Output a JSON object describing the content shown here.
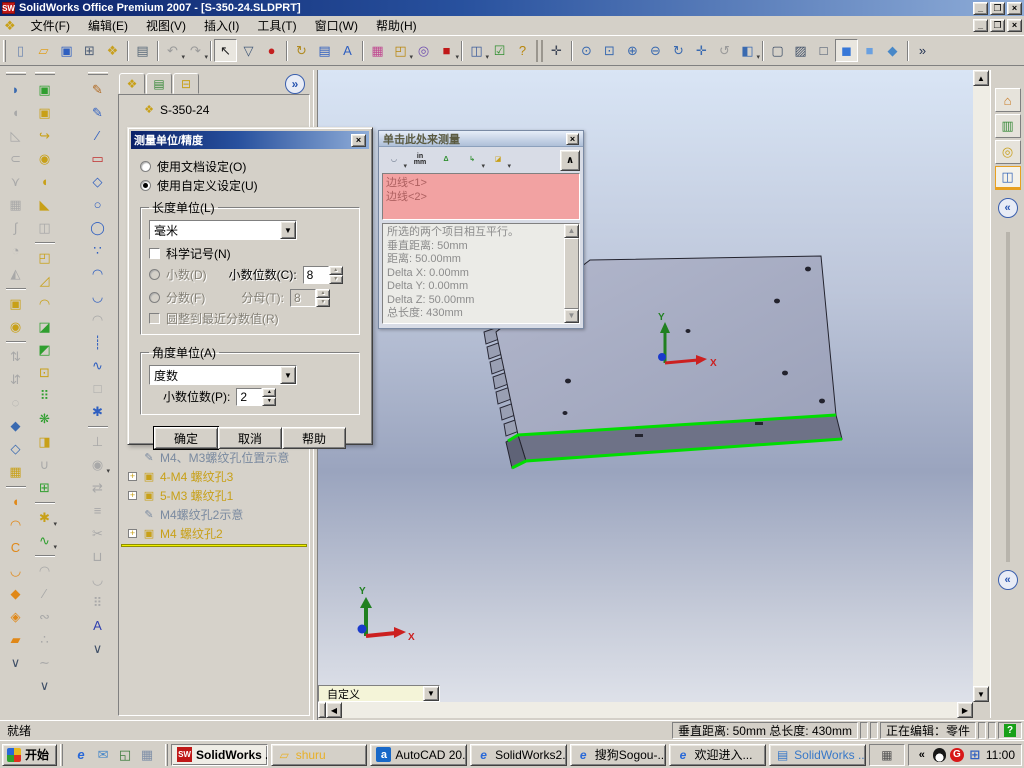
{
  "window": {
    "title": "SolidWorks Office Premium 2007 - [S-350-24.SLDPRT]"
  },
  "menubar": {
    "items": [
      "文件(F)",
      "编辑(E)",
      "视图(V)",
      "插入(I)",
      "工具(T)",
      "窗口(W)",
      "帮助(H)"
    ]
  },
  "main_toolbar": [
    {
      "name": "new-document-icon",
      "glyph": "▯",
      "color": "#7088b0"
    },
    {
      "name": "open-folder-icon",
      "glyph": "▱",
      "color": "#e0a020"
    },
    {
      "name": "save-icon",
      "glyph": "▣",
      "color": "#2f5fc0"
    },
    {
      "name": "make-drawing-icon",
      "glyph": "⊞",
      "color": "#506078"
    },
    {
      "name": "make-assembly-icon",
      "glyph": "❖",
      "color": "#c8a020"
    },
    {
      "cls": "sep"
    },
    {
      "name": "print-icon",
      "glyph": "▤",
      "color": "#5a6a7a"
    },
    {
      "cls": "sep"
    },
    {
      "name": "undo-icon",
      "glyph": "↶",
      "color": "#9a9a9a",
      "cls": "dis drop"
    },
    {
      "name": "redo-icon",
      "glyph": "↷",
      "color": "#9a9a9a",
      "cls": "dis drop"
    },
    {
      "cls": "sep"
    },
    {
      "name": "select-arrow-icon",
      "glyph": "↖",
      "color": "#202020",
      "cls": "pressed"
    },
    {
      "name": "selection-filter-icon",
      "glyph": "▽",
      "color": "#405878"
    },
    {
      "name": "traffic-light-icon",
      "glyph": "●",
      "color": "#c42020"
    },
    {
      "cls": "sep"
    },
    {
      "name": "rebuild-icon",
      "glyph": "↻",
      "color": "#b08a20"
    },
    {
      "name": "section-view-icon",
      "glyph": "▤",
      "color": "#2f5fc0"
    },
    {
      "name": "annotation-scale-icon",
      "glyph": "A",
      "color": "#2f5fc0"
    },
    {
      "cls": "sep"
    },
    {
      "name": "edit-color-icon",
      "glyph": "▦",
      "color": "#c04890"
    },
    {
      "name": "texture-icon",
      "glyph": "◰",
      "color": "#b8860b",
      "cls": "drop"
    },
    {
      "name": "photoworks-render-icon",
      "glyph": "◎",
      "color": "#7050b0"
    },
    {
      "name": "solidworks-cube-icon",
      "glyph": "■",
      "color": "#c01818",
      "cls": "drop"
    },
    {
      "cls": "sep"
    },
    {
      "name": "viewport-split-icon",
      "glyph": "◫",
      "color": "#3a5a9a",
      "cls": "drop"
    },
    {
      "name": "design-checker-icon",
      "glyph": "☑",
      "color": "#2f8f2f"
    },
    {
      "name": "help-icon",
      "glyph": "?",
      "color": "#b8860b"
    },
    {
      "cls": "sep2"
    },
    {
      "name": "magnetic-snap-icon",
      "glyph": "✛",
      "color": "#404858"
    },
    {
      "cls": "sep"
    },
    {
      "name": "zoom-fit-icon",
      "glyph": "⊙",
      "color": "#3a6ab0"
    },
    {
      "name": "zoom-area-icon",
      "glyph": "⊡",
      "color": "#3a6ab0"
    },
    {
      "name": "zoom-in-out-icon",
      "glyph": "⊕",
      "color": "#3a6ab0"
    },
    {
      "name": "zoom-selection-icon",
      "glyph": "⊖",
      "color": "#3a6ab0"
    },
    {
      "name": "rotate-view-icon",
      "glyph": "↻",
      "color": "#3a6ab0"
    },
    {
      "name": "pan-icon",
      "glyph": "✛",
      "color": "#3a6ab0"
    },
    {
      "name": "rotate-about-scene-icon",
      "glyph": "↺",
      "color": "#9a9a9a",
      "cls": "dis"
    },
    {
      "name": "view-orientation-icon",
      "glyph": "◧",
      "color": "#3a6ab0",
      "cls": "drop"
    },
    {
      "cls": "sep"
    },
    {
      "name": "wireframe-icon",
      "glyph": "▢",
      "color": "#405068"
    },
    {
      "name": "hidden-lines-visible-icon",
      "glyph": "▨",
      "color": "#405068"
    },
    {
      "name": "hidden-lines-removed-icon",
      "glyph": "□",
      "color": "#405068"
    },
    {
      "name": "shaded-with-edges-icon",
      "glyph": "◼",
      "color": "#3878d8",
      "cls": "pressed"
    },
    {
      "name": "shaded-icon",
      "glyph": "■",
      "color": "#6aa0e0"
    },
    {
      "name": "shadows-icon",
      "glyph": "◆",
      "color": "#4888c8"
    },
    {
      "cls": "sep"
    },
    {
      "name": "toolbar-overflow-icon",
      "glyph": "»",
      "color": "#203050"
    }
  ],
  "toolbar_surfaces": [
    {
      "name": "extruded-surface-icon",
      "glyph": "◗",
      "color": "#3a6ab0"
    },
    {
      "name": "lofted-surface-icon",
      "glyph": "◖",
      "color": "#a8a8a8",
      "cls": "dis"
    },
    {
      "name": "planar-surface-icon",
      "glyph": "◺",
      "color": "#a8a8a8",
      "cls": "dis"
    },
    {
      "name": "offset-surface-icon",
      "glyph": "⊂",
      "color": "#a8a8a8",
      "cls": "dis"
    },
    {
      "name": "ruled-surface-icon",
      "glyph": "⋎",
      "color": "#a8a8a8",
      "cls": "dis"
    },
    {
      "name": "knit-surface-icon",
      "glyph": "▦",
      "color": "#a8a8a8",
      "cls": "dis"
    },
    {
      "name": "swept-surface-icon",
      "glyph": "∫",
      "color": "#a8a8a8",
      "cls": "dis"
    },
    {
      "name": "fill-surface-icon",
      "glyph": "◔",
      "color": "#a8a8a8",
      "cls": "dis"
    },
    {
      "name": "mid-surface-icon",
      "glyph": "◭",
      "color": "#a8a8a8",
      "cls": "dis"
    },
    {
      "cls": "sep"
    },
    {
      "name": "extend-surface-icon",
      "glyph": "▣",
      "color": "#c8a018"
    },
    {
      "name": "trim-surface-icon",
      "glyph": "◉",
      "color": "#c8a018"
    },
    {
      "cls": "sep"
    },
    {
      "name": "replace-face-icon",
      "glyph": "⇅",
      "color": "#a8a8a8",
      "cls": "dis"
    },
    {
      "name": "delete-face-icon",
      "glyph": "⇵",
      "color": "#a8a8a8",
      "cls": "dis"
    },
    {
      "name": "untrim-surface-icon",
      "glyph": "◌",
      "color": "#a8a8a8",
      "cls": "dis"
    },
    {
      "name": "fold-icon",
      "glyph": "◆",
      "color": "#3a6ab0"
    },
    {
      "name": "unfold-icon",
      "glyph": "◇",
      "color": "#3a6ab0"
    },
    {
      "name": "flat-pattern-icon",
      "glyph": "▦",
      "color": "#c8a018"
    },
    {
      "cls": "sep"
    },
    {
      "name": "wrap-icon",
      "glyph": "◖",
      "color": "#e08818"
    },
    {
      "name": "dome-icon",
      "glyph": "◠",
      "color": "#e08818"
    },
    {
      "name": "flex-icon",
      "glyph": "C",
      "color": "#e08818"
    },
    {
      "name": "deform-icon",
      "glyph": "◡",
      "color": "#e08818"
    },
    {
      "name": "indent-icon",
      "glyph": "◆",
      "color": "#e08818"
    },
    {
      "name": "split-body-icon",
      "glyph": "◈",
      "color": "#e08818"
    },
    {
      "name": "thicken-icon",
      "glyph": "▰",
      "color": "#e08818"
    },
    {
      "name": "toolbar-more-icon",
      "glyph": "∨",
      "color": "#405068"
    }
  ],
  "toolbar_features": [
    {
      "name": "extruded-boss-icon",
      "glyph": "▣",
      "color": "#2f9f2f"
    },
    {
      "name": "revolved-boss-icon",
      "glyph": "▣",
      "color": "#c8a018"
    },
    {
      "name": "swept-boss-icon",
      "glyph": "↪",
      "color": "#c8a018"
    },
    {
      "name": "hole-wizard-icon",
      "glyph": "◉",
      "color": "#c8a018"
    },
    {
      "name": "fillet-icon",
      "glyph": "◖",
      "color": "#c8a018"
    },
    {
      "name": "chamfer-icon",
      "glyph": "◣",
      "color": "#c8a018"
    },
    {
      "name": "rib-icon",
      "glyph": "◫",
      "color": "#a8a8a8",
      "cls": "dis"
    },
    {
      "cls": "sep"
    },
    {
      "name": "shell-icon",
      "glyph": "◰",
      "color": "#c8a018"
    },
    {
      "name": "draft-icon",
      "glyph": "◿",
      "color": "#c8a018"
    },
    {
      "name": "dome-feature-icon",
      "glyph": "◠",
      "color": "#c8a018"
    },
    {
      "name": "extruded-cut-icon",
      "glyph": "◪",
      "color": "#2f9f2f"
    },
    {
      "name": "revolved-cut-icon",
      "glyph": "◩",
      "color": "#2f9f2f"
    },
    {
      "name": "simple-hole-icon",
      "glyph": "⊡",
      "color": "#c8a018"
    },
    {
      "name": "linear-pattern-icon",
      "glyph": "⠿",
      "color": "#2f9f2f"
    },
    {
      "name": "circular-pattern-icon",
      "glyph": "❋",
      "color": "#2f9f2f"
    },
    {
      "name": "mirror-feature-icon",
      "glyph": "◨",
      "color": "#c8a018"
    },
    {
      "name": "combine-icon",
      "glyph": "∪",
      "color": "#a8a8a8",
      "cls": "dis"
    },
    {
      "name": "move-copy-body-icon",
      "glyph": "⊞",
      "color": "#2f9f2f"
    },
    {
      "cls": "sep"
    },
    {
      "name": "reference-point-icon",
      "glyph": "✱",
      "color": "#c8a018",
      "cls": "drop"
    },
    {
      "name": "helix-spiral-icon",
      "glyph": "∿",
      "color": "#2f9f2f",
      "cls": "drop"
    },
    {
      "cls": "sep"
    },
    {
      "name": "projected-curve-icon",
      "glyph": "◠",
      "color": "#a8a8a8",
      "cls": "dis"
    },
    {
      "name": "split-line-icon",
      "glyph": "∕",
      "color": "#a8a8a8",
      "cls": "dis"
    },
    {
      "name": "composite-curve-icon",
      "glyph": "∾",
      "color": "#a8a8a8",
      "cls": "dis"
    },
    {
      "name": "curve-through-points-icon",
      "glyph": "∴",
      "color": "#a8a8a8",
      "cls": "dis"
    },
    {
      "name": "freeform-curve-icon",
      "glyph": "∼",
      "color": "#a8a8a8",
      "cls": "dis"
    },
    {
      "name": "toolbar-more-icon",
      "glyph": "∨",
      "color": "#405068"
    }
  ],
  "toolbar_sketch": [
    {
      "name": "sketch-icon",
      "glyph": "✎",
      "color": "#b06820"
    },
    {
      "name": "3d-sketch-icon",
      "glyph": "✎",
      "color": "#2f5fc0"
    },
    {
      "name": "line-icon",
      "glyph": "∕",
      "color": "#2f5fc0"
    },
    {
      "name": "rectangle-icon",
      "glyph": "▭",
      "color": "#c03030"
    },
    {
      "name": "polygon-icon",
      "glyph": "◇",
      "color": "#2f5fc0"
    },
    {
      "name": "circle-icon",
      "glyph": "○",
      "color": "#2f5fc0"
    },
    {
      "name": "ellipse-icon",
      "glyph": "◯",
      "color": "#2f5fc0"
    },
    {
      "name": "spline-on-surface-icon",
      "glyph": "∵",
      "color": "#2f5fc0"
    },
    {
      "name": "three-point-arc-icon",
      "glyph": "◠",
      "color": "#2f5fc0"
    },
    {
      "name": "centerpoint-arc-icon",
      "glyph": "◡",
      "color": "#2f5fc0"
    },
    {
      "name": "tangent-arc-icon",
      "glyph": "◠",
      "color": "#a8a8a8",
      "cls": "dis"
    },
    {
      "name": "centerline-icon",
      "glyph": "┊",
      "color": "#2f5fc0"
    },
    {
      "name": "spline-icon",
      "glyph": "∿",
      "color": "#2f5fc0"
    },
    {
      "name": "parallelogram-icon",
      "glyph": "□",
      "color": "#a8a8a8",
      "cls": "dis"
    },
    {
      "name": "point-icon",
      "glyph": "✱",
      "color": "#2f5fc0"
    },
    {
      "cls": "sep"
    },
    {
      "name": "add-relation-icon",
      "glyph": "⊥",
      "color": "#a8a8a8",
      "cls": "dis"
    },
    {
      "name": "display-relations-icon",
      "glyph": "◉",
      "color": "#a8a8a8",
      "cls": "dis drop"
    },
    {
      "name": "mirror-entities-icon",
      "glyph": "⇄",
      "color": "#a8a8a8",
      "cls": "dis"
    },
    {
      "name": "offset-entities-icon",
      "glyph": "≡",
      "color": "#a8a8a8",
      "cls": "dis"
    },
    {
      "name": "trim-entities-icon",
      "glyph": "✂",
      "color": "#a8a8a8",
      "cls": "dis"
    },
    {
      "name": "convert-entities-icon",
      "glyph": "⊔",
      "color": "#a8a8a8",
      "cls": "dis"
    },
    {
      "name": "sketch-fillet-icon",
      "glyph": "◡",
      "color": "#a8a8a8",
      "cls": "dis"
    },
    {
      "name": "linear-sketch-pattern-icon",
      "glyph": "⠿",
      "color": "#a8a8a8",
      "cls": "dis"
    },
    {
      "name": "sketch-text-icon",
      "glyph": "A",
      "color": "#2f3fb0"
    },
    {
      "name": "toolbar-more-icon",
      "glyph": "∨",
      "color": "#405068"
    }
  ],
  "fm_tabs": [
    {
      "name": "featuremanager-tab-icon",
      "glyph": "❖",
      "color": "#c8a018"
    },
    {
      "name": "propertymanager-tab-icon",
      "glyph": "▤",
      "color": "#3a8a3a"
    },
    {
      "name": "configurationmanager-tab-icon",
      "glyph": "⊟",
      "color": "#c8a018"
    }
  ],
  "fm_chevron": "»",
  "tree": {
    "root": "S-350-24",
    "root_icon": "❖",
    "items": [
      {
        "label": "M4、M3螺纹孔位置示意",
        "glyph": "✎",
        "color": "#7a8aa0",
        "cls": "noplus"
      },
      {
        "label": "4-M4 螺纹孔3",
        "glyph": "▣",
        "color": "#c8a018",
        "plus": "+"
      },
      {
        "label": "5-M3 螺纹孔1",
        "glyph": "▣",
        "color": "#c8a018",
        "plus": "+"
      },
      {
        "label": "M4螺纹孔2示意",
        "glyph": "✎",
        "color": "#7a8aa0",
        "cls": "noplus"
      },
      {
        "label": "M4 螺纹孔2",
        "glyph": "▣",
        "color": "#c8a018",
        "plus": "+"
      }
    ]
  },
  "dialog": {
    "title": "测量单位/精度",
    "radio_doc": "使用文档设定(O)",
    "radio_custom": "使用自定义设定(U)",
    "group_length": "长度单位(L)",
    "length_unit": "毫米",
    "sci_notation": "科学记号(N)",
    "radio_decimal": "小数(D)",
    "decimal_places_label": "小数位数(C):",
    "decimal_places": "8",
    "radio_fraction": "分数(F)",
    "denominator_label": "分母(T):",
    "denominator": "8",
    "round_label": "圆整到最近分数值(R)",
    "group_angle": "角度单位(A)",
    "angle_unit": "度数",
    "angle_places_label": "小数位数(P):",
    "angle_places": "2",
    "ok": "确定",
    "cancel": "取消",
    "help": "帮助"
  },
  "measure": {
    "title": "单击此处来测量",
    "toolbar": [
      {
        "name": "arc-measure-icon",
        "glyph": "◡",
        "color": "#405068",
        "cls": "drop"
      },
      {
        "name": "units-in-mm-icon",
        "glyph": "in\nmm",
        "color": "#202020",
        "cls": "txt"
      },
      {
        "name": "xyz-measure-icon",
        "glyph": "Δ",
        "color": "#2f8f2f"
      },
      {
        "name": "coordinate-system-icon",
        "glyph": "↳",
        "color": "#2f8f2f",
        "cls": "drop"
      },
      {
        "name": "projection-measure-icon",
        "glyph": "◪",
        "color": "#c8a018",
        "cls": "drop"
      }
    ],
    "collapse_glyph": "∧",
    "selection": [
      "边线<1>",
      "边线<2>"
    ],
    "results": [
      "所选的两个项目相互平行。",
      "垂直距离: 50mm",
      "距离: 50.00mm",
      "Delta X: 0.00mm",
      "Delta Y: 0.00mm",
      "Delta Z: 50.00mm",
      "总长度: 430mm"
    ]
  },
  "viewport": {
    "combo_value": "自定义",
    "axis_x": "X",
    "axis_y": "Y"
  },
  "taskpane": {
    "tabs": [
      {
        "name": "solidworks-resources-tab-icon",
        "glyph": "⌂",
        "color": "#c87820"
      },
      {
        "name": "design-library-tab-icon",
        "glyph": "▥",
        "color": "#3a8a3a"
      },
      {
        "name": "file-explorer-tab-icon",
        "glyph": "◎",
        "color": "#c8a020"
      },
      {
        "name": "view-palette-tab-icon",
        "glyph": "◫",
        "color": "#3868b8",
        "cls": "sel"
      }
    ],
    "collapse_glyph": "«"
  },
  "statusbar": {
    "ready": "就绪",
    "measurement": "垂直距离: 50mm  总长度: 430mm",
    "editing": "正在编辑：零件",
    "help_glyph": "?"
  },
  "taskbar": {
    "start": "开始",
    "quick_launch": [
      {
        "name": "internet-explorer-icon",
        "glyph": "e",
        "color": "#2868d8"
      },
      {
        "name": "mail-icon",
        "glyph": "✉",
        "color": "#4888c8"
      },
      {
        "name": "show-desktop-icon",
        "glyph": "◱",
        "color": "#3a7a3a"
      },
      {
        "name": "media-player-icon",
        "glyph": "▦",
        "color": "#8090a8"
      }
    ],
    "tasks": [
      {
        "label": "SolidWorks ...",
        "name": "task-solidworks",
        "cls": "active ico-sw",
        "glyph": "SW"
      },
      {
        "label": "shuru",
        "name": "task-shuru-folder",
        "glyph": "▱",
        "color": "#e8b028"
      },
      {
        "label": "AutoCAD 20...",
        "name": "task-autocad",
        "cls": "ico-acad",
        "glyph": "a"
      },
      {
        "label": "SolidWorks2...",
        "name": "task-solidworks2",
        "cls": "ico-ie",
        "glyph": "e"
      },
      {
        "label": "搜狗Sogou-...",
        "name": "task-sogou",
        "cls": "ico-ie",
        "glyph": "e"
      },
      {
        "label": "欢迎进入...",
        "name": "task-welcome",
        "cls": "ico-ie",
        "glyph": "e"
      },
      {
        "label": "SolidWorks ...",
        "name": "task-solidworks-doc",
        "glyph": "▤",
        "color": "#3878c8"
      }
    ],
    "tray_collapse": "«",
    "clock": "11:00"
  }
}
